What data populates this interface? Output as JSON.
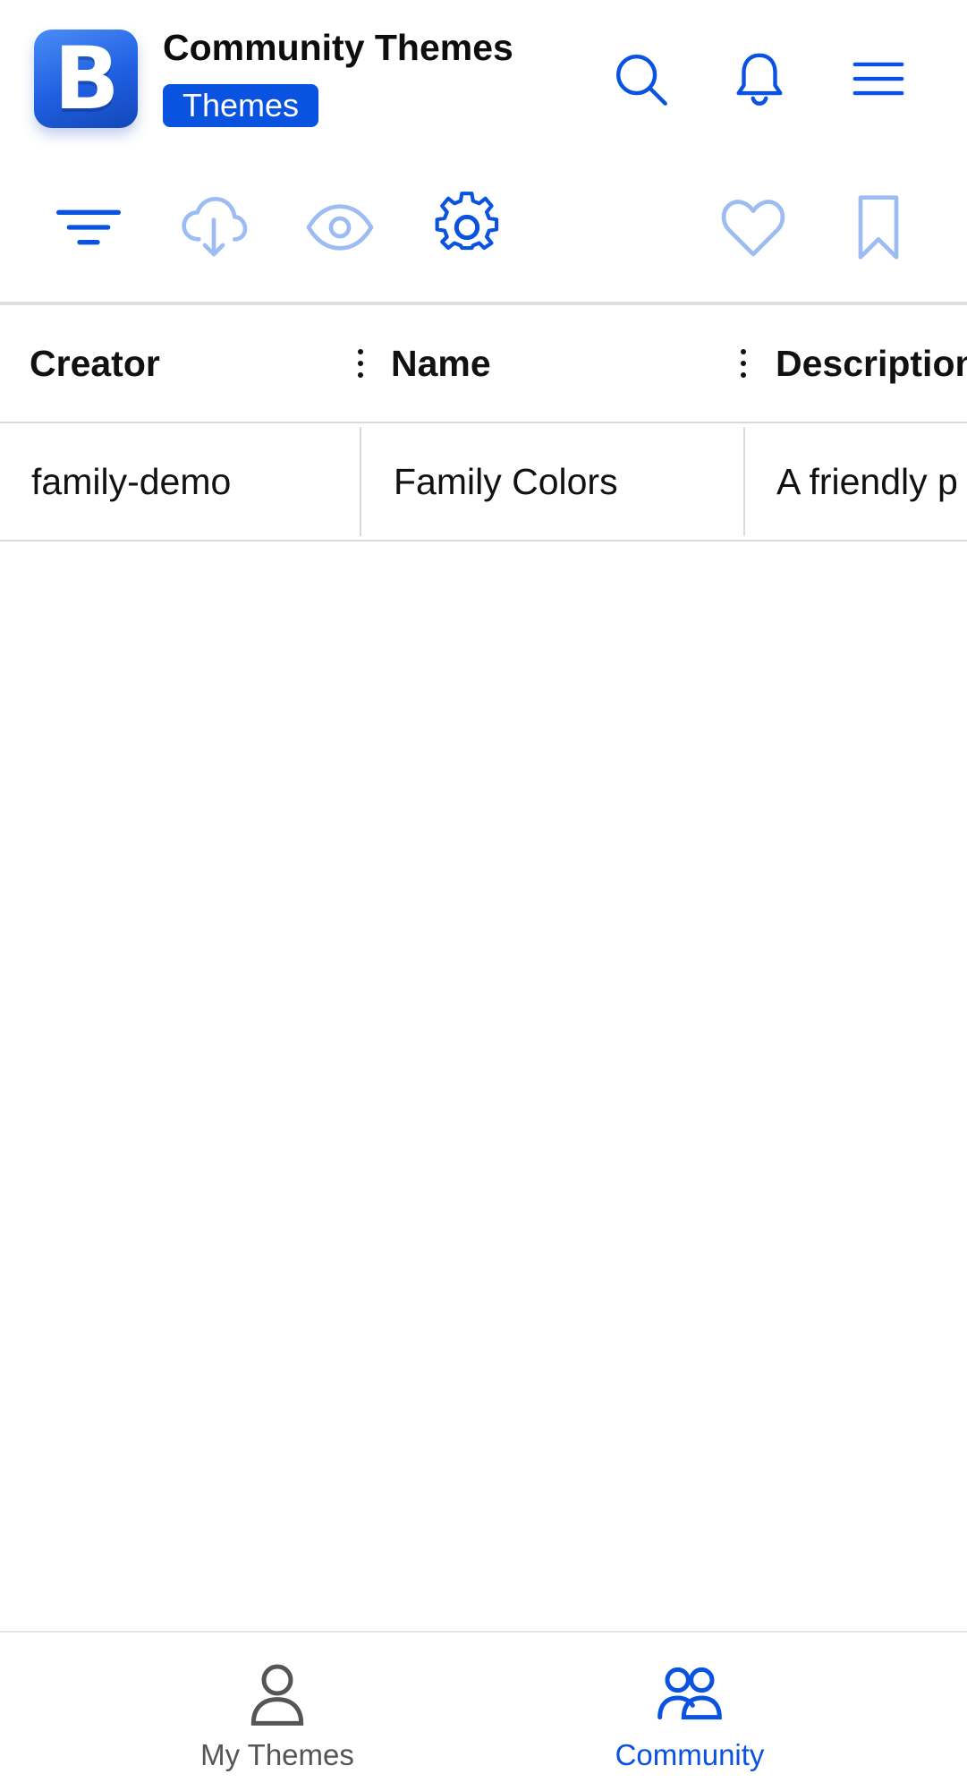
{
  "header": {
    "logo_letter": "B",
    "title": "Community Themes",
    "badge": "Themes",
    "icons": [
      "search-icon",
      "bell-icon",
      "hamburger-menu-icon"
    ]
  },
  "toolbar": {
    "icons": [
      "filter-icon",
      "cloud-download-icon",
      "eye-icon",
      "gear-icon",
      "heart-icon",
      "bookmark-icon"
    ]
  },
  "table": {
    "columns": [
      "Creator",
      "Name",
      "Description"
    ],
    "rows": [
      {
        "creator": "family-demo",
        "name": "Family Colors",
        "description": "A friendly p"
      }
    ]
  },
  "bottom_nav": {
    "items": [
      {
        "label": "My Themes",
        "icon": "person-icon",
        "active": false
      },
      {
        "label": "Community",
        "icon": "people-icon",
        "active": true
      }
    ]
  },
  "colors": {
    "accent": "#0a52e0",
    "accent_light": "#9dbcf3",
    "inactive": "#555555",
    "divider": "#d8dbe2"
  }
}
